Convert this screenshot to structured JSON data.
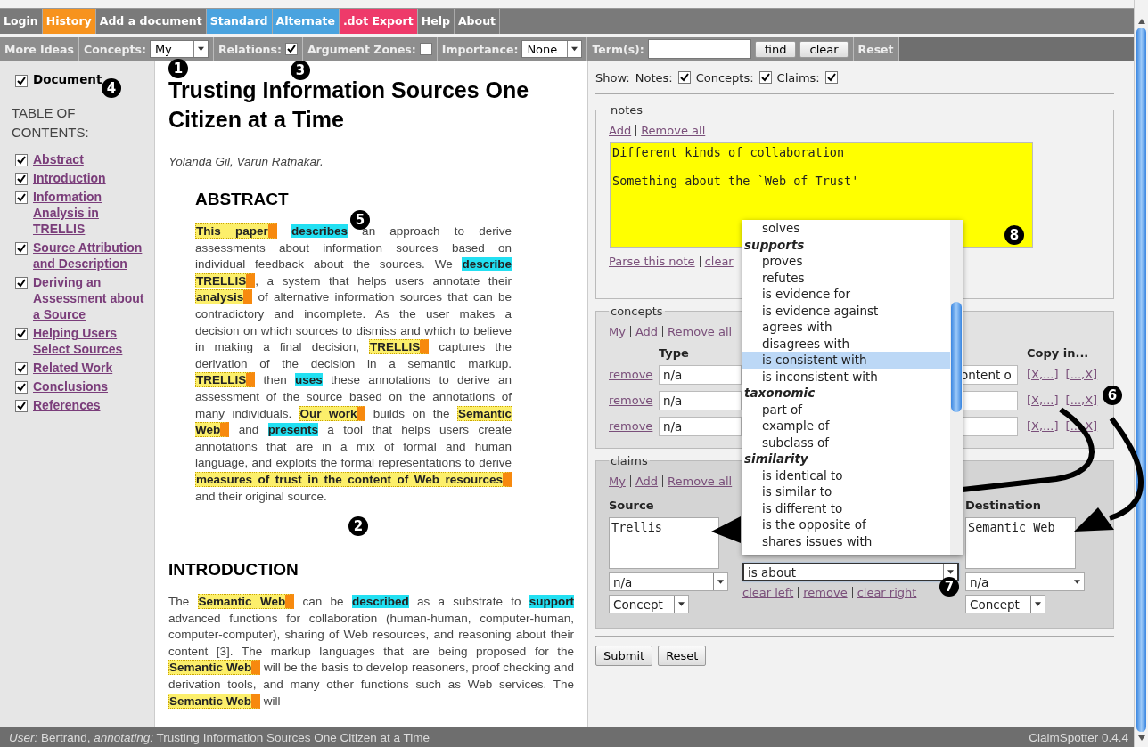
{
  "menu": [
    {
      "label": "Login"
    },
    {
      "label": "History",
      "color": "#f7931e"
    },
    {
      "label": "Add a document"
    },
    {
      "label": "Standard",
      "color": "#4aa3df"
    },
    {
      "label": "Alternate",
      "color": "#4aa3df"
    },
    {
      "label": ".dot Export",
      "color": "#ee3a6a"
    },
    {
      "label": "Help"
    },
    {
      "label": "About"
    }
  ],
  "toolbar": {
    "more_ideas": "More Ideas",
    "concepts": {
      "label": "Concepts:",
      "value": "My"
    },
    "relations": {
      "label": "Relations:",
      "checked": true
    },
    "argument_zones": {
      "label": "Argument Zones:",
      "checked": false
    },
    "importance": {
      "label": "Importance:",
      "value": "None"
    },
    "terms": {
      "label": "Term(s):"
    },
    "find": "find",
    "clear": "clear",
    "reset": "Reset"
  },
  "sidebar": {
    "document": {
      "label": "Document",
      "checked": true
    },
    "heading": "TABLE OF CONTENTS:",
    "items": [
      {
        "label": "Abstract",
        "checked": true
      },
      {
        "label": "Introduction",
        "checked": true
      },
      {
        "label": "Information Analysis in TRELLIS",
        "checked": true
      },
      {
        "label": "Source Attribution and Description",
        "checked": true
      },
      {
        "label": "Deriving an Assessment about a Source",
        "checked": true
      },
      {
        "label": "Helping Users Select Sources",
        "checked": true
      },
      {
        "label": "Related Work",
        "checked": true
      },
      {
        "label": "Conclusions",
        "checked": true
      },
      {
        "label": "References",
        "checked": true
      }
    ]
  },
  "document": {
    "title": "Trusting Information Sources One Citizen at a Time",
    "authors": "Yolanda Gil, Varun Ratnakar.",
    "sections": [
      {
        "heading": "ABSTRACT",
        "indented": true,
        "segments": [
          {
            "text": "This paper",
            "kind": "concept",
            "space_after": true
          },
          {
            "text": "describes",
            "kind": "relation"
          },
          {
            "text": " an approach to derive assessments about information sources based on individual feedback about the sources. We ",
            "kind": "plain"
          },
          {
            "text": "describe",
            "kind": "relation",
            "space_after": true
          },
          {
            "text": "TRELLIS",
            "kind": "concept"
          },
          {
            "text": ", a system that helps users annotate their ",
            "kind": "plain"
          },
          {
            "text": "analysis",
            "kind": "concept"
          },
          {
            "text": " of alternative information sources that can be contradictory and incomplete. As the user makes a decision on which sources to dismiss and which to believe in making a final decision, ",
            "kind": "plain"
          },
          {
            "text": "TRELLIS",
            "kind": "concept"
          },
          {
            "text": " captures the derivation of the decision in a semantic markup. ",
            "kind": "plain"
          },
          {
            "text": "TRELLIS",
            "kind": "concept"
          },
          {
            "text": " then ",
            "kind": "plain"
          },
          {
            "text": "uses",
            "kind": "relation"
          },
          {
            "text": " these annotations to derive an assessment of the source based on the annotations of many individuals. ",
            "kind": "plain"
          },
          {
            "text": "Our work",
            "kind": "concept"
          },
          {
            "text": " builds on the ",
            "kind": "plain"
          },
          {
            "text": "Semantic Web",
            "kind": "concept"
          },
          {
            "text": " and ",
            "kind": "plain"
          },
          {
            "text": "presents",
            "kind": "relation"
          },
          {
            "text": " a tool that helps users create annotations that are in a mix of formal and human language, and exploits the formal representations to derive ",
            "kind": "plain"
          },
          {
            "text": "measures of trust in the content of Web resources",
            "kind": "concept"
          },
          {
            "text": " and their original source.",
            "kind": "plain"
          }
        ]
      },
      {
        "heading": "INTRODUCTION",
        "indented": false,
        "segments": [
          {
            "text": "The ",
            "kind": "plain"
          },
          {
            "text": "Semantic Web",
            "kind": "concept"
          },
          {
            "text": " can be ",
            "kind": "plain"
          },
          {
            "text": "described",
            "kind": "relation"
          },
          {
            "text": " as a substrate to ",
            "kind": "plain"
          },
          {
            "text": "support",
            "kind": "relation"
          },
          {
            "text": " advanced functions for collaboration (human-human, computer-human, computer-computer), sharing of Web resources, and reasoning about their content [3]. The markup languages that are being proposed for the ",
            "kind": "plain"
          },
          {
            "text": "Semantic Web",
            "kind": "concept"
          },
          {
            "text": " will be the basis to develop reasoners, proof checking and derivation tools, and many other functions such as Web services. The ",
            "kind": "plain"
          },
          {
            "text": "Semantic Web",
            "kind": "concept"
          },
          {
            "text": " will",
            "kind": "plain"
          }
        ]
      }
    ]
  },
  "panel": {
    "show": {
      "label": "Show:",
      "toggles": [
        {
          "label": "Notes:",
          "checked": true
        },
        {
          "label": "Concepts:",
          "checked": true
        },
        {
          "label": "Claims:",
          "checked": true
        }
      ]
    },
    "notes": {
      "legend": "notes",
      "links": [
        "Add",
        "Remove all"
      ],
      "text": "Different kinds of collaboration\n\nSomething about the `Web of Trust'",
      "footer_links": [
        "Parse this note",
        "clear"
      ]
    },
    "concepts": {
      "legend": "concepts",
      "links": [
        "My",
        "Add",
        "Remove all"
      ],
      "type_header": "Type",
      "copy_header": "Copy in...",
      "rows": [
        {
          "remove": "remove",
          "type": "n/a",
          "value": "ontent o",
          "copy_left": "[X,...]",
          "copy_right": "[...,X]"
        },
        {
          "remove": "remove",
          "type": "n/a",
          "copy_left": "[X,...]",
          "copy_right": "[...,X]"
        },
        {
          "remove": "remove",
          "type": "n/a",
          "copy_left": "[X,...]",
          "copy_right": "[...,X]"
        }
      ]
    },
    "claims": {
      "legend": "claims",
      "links": [
        "My",
        "Add",
        "Remove all"
      ],
      "source": {
        "label": "Source",
        "text": "Trellis",
        "value": "n/a",
        "type": "Concept"
      },
      "destination": {
        "label": "Destination",
        "text": "Semantic Web",
        "value": "n/a",
        "type": "Concept"
      },
      "relation": "is about",
      "actions": [
        "clear left",
        "remove",
        "clear right"
      ]
    },
    "dropdown": [
      {
        "label": "solves",
        "kind": "option",
        "selected": false
      },
      {
        "label": "supports",
        "kind": "group",
        "selected": false
      },
      {
        "label": "proves",
        "kind": "option",
        "selected": false
      },
      {
        "label": "refutes",
        "kind": "option",
        "selected": false
      },
      {
        "label": "is evidence for",
        "kind": "option",
        "selected": false
      },
      {
        "label": "is evidence against",
        "kind": "option",
        "selected": false
      },
      {
        "label": "agrees with",
        "kind": "option",
        "selected": false
      },
      {
        "label": "disagrees with",
        "kind": "option",
        "selected": false
      },
      {
        "label": "is consistent with",
        "kind": "option",
        "selected": true
      },
      {
        "label": "is inconsistent with",
        "kind": "option",
        "selected": false
      },
      {
        "label": "taxonomic",
        "kind": "group",
        "selected": false
      },
      {
        "label": "part of",
        "kind": "option",
        "selected": false
      },
      {
        "label": "example of",
        "kind": "option",
        "selected": false
      },
      {
        "label": "subclass of",
        "kind": "option",
        "selected": false
      },
      {
        "label": "similarity",
        "kind": "group",
        "selected": false
      },
      {
        "label": "is identical to",
        "kind": "option",
        "selected": false
      },
      {
        "label": "is similar to",
        "kind": "option",
        "selected": false
      },
      {
        "label": "is different to",
        "kind": "option",
        "selected": false
      },
      {
        "label": "is the opposite of",
        "kind": "option",
        "selected": false
      },
      {
        "label": "shares issues with",
        "kind": "option",
        "selected": false
      }
    ],
    "buttons": [
      "Submit",
      "Reset"
    ]
  },
  "callouts": [
    "1",
    "2",
    "3",
    "4",
    "5",
    "6",
    "7",
    "8"
  ],
  "status": {
    "text": "*User:* Bertrand, *annotating:* Trusting Information Sources One Citizen at a Time",
    "version": "ClaimSpotter 0.4.4"
  }
}
